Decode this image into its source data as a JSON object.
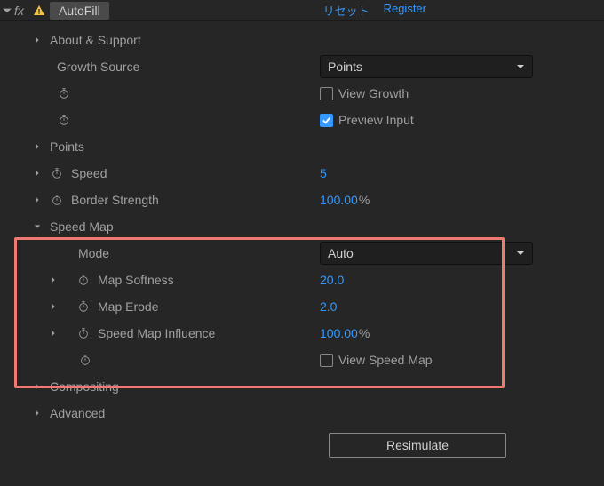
{
  "header": {
    "effect_name": "AutoFill",
    "reset_label": "リセット",
    "register_label": "Register"
  },
  "props": {
    "about_support": "About & Support",
    "growth_source": {
      "label": "Growth Source",
      "value": "Points"
    },
    "view_growth": "View Growth",
    "preview_input": "Preview Input",
    "points": "Points",
    "speed": {
      "label": "Speed",
      "value": "5"
    },
    "border_strength": {
      "label": "Border Strength",
      "value": "100.00",
      "unit": "%"
    },
    "speed_map": {
      "label": "Speed Map",
      "mode": {
        "label": "Mode",
        "value": "Auto"
      },
      "map_softness": {
        "label": "Map Softness",
        "value": "20.0"
      },
      "map_erode": {
        "label": "Map Erode",
        "value": "2.0"
      },
      "influence": {
        "label": "Speed Map Influence",
        "value": "100.00",
        "unit": "%"
      },
      "view_speed_map": "View Speed Map"
    },
    "compositing": "Compositing",
    "advanced": "Advanced",
    "resimulate": "Resimulate"
  }
}
